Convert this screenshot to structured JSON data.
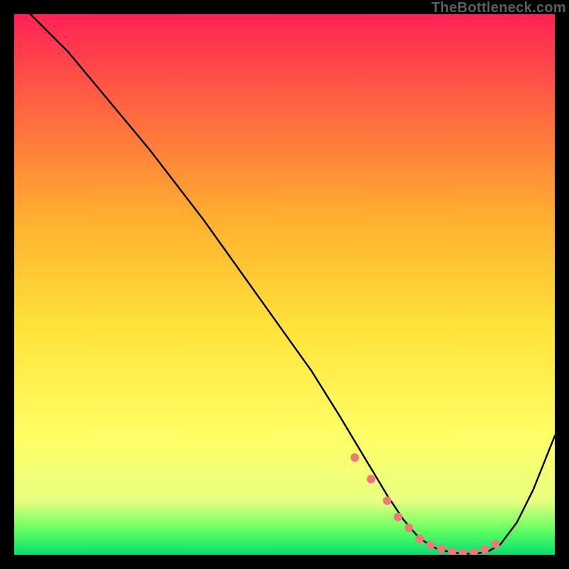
{
  "attribution": "TheBottleneck.com",
  "chart_data": {
    "type": "line",
    "title": "",
    "xlabel": "",
    "ylabel": "",
    "xlim": [
      0,
      100
    ],
    "ylim": [
      0,
      100
    ],
    "grid": false,
    "background_gradient": [
      "#ff2255",
      "#ff6840",
      "#ffb030",
      "#ffe33a",
      "#ffff66",
      "#e8ff80",
      "#62ff62",
      "#00e070"
    ],
    "curve": {
      "name": "bottleneck",
      "x": [
        3,
        10,
        15,
        20,
        25,
        30,
        35,
        40,
        45,
        50,
        55,
        60,
        63,
        66,
        69,
        72,
        75,
        78,
        81,
        84,
        86,
        88,
        90,
        93,
        96,
        100
      ],
      "y": [
        100,
        93,
        87,
        81,
        75,
        68.5,
        62,
        55,
        48,
        41,
        34,
        26,
        21,
        16,
        11,
        6.5,
        3,
        1.2,
        0.4,
        0.2,
        0.3,
        0.8,
        2,
        6,
        12,
        22
      ]
    },
    "markers": {
      "name": "highlight-band",
      "x": [
        63,
        66,
        69,
        71,
        73,
        75,
        77,
        79,
        81,
        83,
        85,
        87,
        89
      ],
      "y": [
        18,
        14,
        10,
        7,
        5,
        3,
        1.8,
        1.1,
        0.6,
        0.4,
        0.5,
        1.0,
        2.0
      ]
    }
  }
}
